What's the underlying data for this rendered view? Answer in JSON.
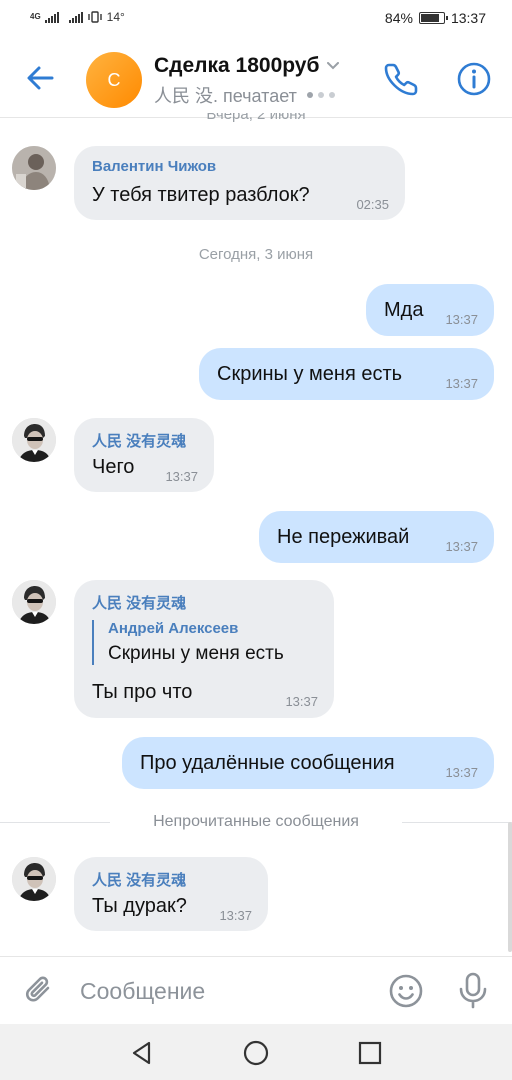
{
  "status_bar": {
    "network_1": "4G",
    "network_2": "4G",
    "temperature": "14°",
    "battery_percent": "84%",
    "battery_level": 0.84,
    "time": "13:37"
  },
  "header": {
    "avatar_letter": "С",
    "chat_title": "Сделка 1800руб",
    "typing_status": "人民 没. печатает",
    "accent_color": "#2f7cd3"
  },
  "date_separators": {
    "previous": "Вчера, 2 июня",
    "today": "Сегодня, 3 июня"
  },
  "messages": [
    {
      "sender": "Валентин Чижов",
      "text": "У тебя твитер разблок?",
      "time": "02:35",
      "direction": "in"
    },
    {
      "text": "Мда",
      "time": "13:37",
      "direction": "out"
    },
    {
      "text": "Скрины у меня есть",
      "time": "13:37",
      "direction": "out"
    },
    {
      "sender": "人民 没有灵魂",
      "text": "Чего",
      "time": "13:37",
      "direction": "in"
    },
    {
      "text": "Не переживай",
      "time": "13:37",
      "direction": "out"
    },
    {
      "sender": "人民 没有灵魂",
      "reply_to_name": "Андрей Алексеев",
      "reply_to_text": "Скрины у меня есть",
      "text": "Ты про что",
      "time": "13:37",
      "direction": "in"
    },
    {
      "text": "Про удалённые сообщения",
      "time": "13:37",
      "direction": "out"
    },
    {
      "sender": "人民 没有灵魂",
      "text": "Ты дурак?",
      "time": "13:37",
      "direction": "in"
    }
  ],
  "unread_label": "Непрочитанные сообщения",
  "composer": {
    "placeholder": "Сообщение",
    "icons": [
      "paperclip-icon",
      "smile-icon",
      "microphone-icon"
    ]
  },
  "colors": {
    "outgoing_bubble": "#cce4ff",
    "incoming_bubble": "#ebedf0",
    "sender_name": "#4a7fbd"
  }
}
